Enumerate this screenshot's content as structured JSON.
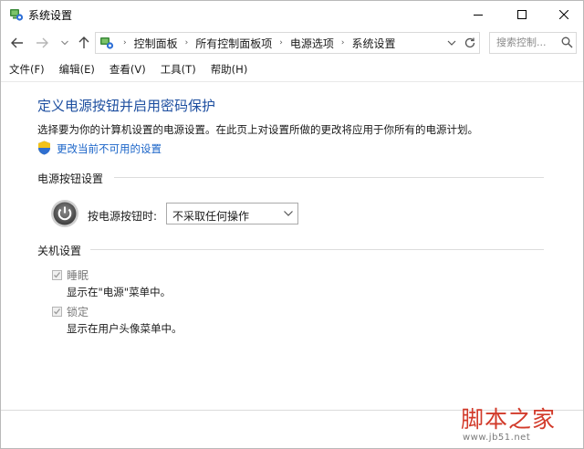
{
  "window": {
    "title": "系统设置",
    "icon": "control-panel-icon"
  },
  "nav": {
    "breadcrumbs": [
      "控制面板",
      "所有控制面板项",
      "电源选项",
      "系统设置"
    ],
    "search_placeholder": "搜索控制..."
  },
  "menu": [
    "文件(F)",
    "编辑(E)",
    "查看(V)",
    "工具(T)",
    "帮助(H)"
  ],
  "content": {
    "title": "定义电源按钮并启用密码保护",
    "description": "选择要为你的计算机设置的电源设置。在此页上对设置所做的更改将应用于你所有的电源计划。",
    "change_link": "更改当前不可用的设置",
    "power_section": "电源按钮设置",
    "power_label": "按电源按钮时:",
    "power_action": "不采取任何操作",
    "shutdown_section": "关机设置",
    "sleep_label": "睡眠",
    "sleep_desc": "显示在\"电源\"菜单中。",
    "sleep_checked": true,
    "lock_label": "锁定",
    "lock_desc": "显示在用户头像菜单中。",
    "lock_checked": true
  },
  "watermark": {
    "main": "脚本之家",
    "sub": "www.jb51.net"
  },
  "colors": {
    "title_blue": "#1e4fa0",
    "link_blue": "#1a64c8",
    "watermark_red": "#d23a2a"
  }
}
